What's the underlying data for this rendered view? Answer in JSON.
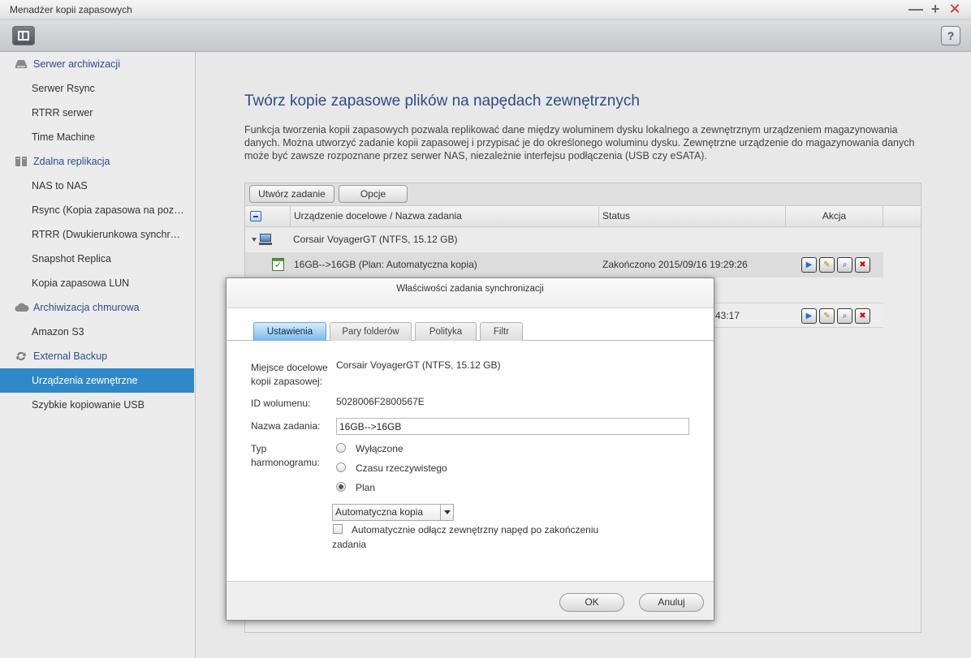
{
  "window": {
    "title": "Menadżer kopii zapasowych",
    "minimize": "—",
    "maximize": "+",
    "close": "✕"
  },
  "toolbar": {
    "help": "?"
  },
  "sidebar": {
    "groups": [
      {
        "label": "Serwer archiwizacji",
        "icon": "server-icon"
      },
      {
        "label": "Zdalna replikacja",
        "icon": "replication-icon"
      },
      {
        "label": "Archiwizacja chmurowa",
        "icon": "cloud-icon"
      },
      {
        "label": "External Backup",
        "icon": "sync-icon"
      }
    ],
    "items": [
      {
        "label": "Serwer Rsync"
      },
      {
        "label": "RTRR serwer"
      },
      {
        "label": "Time Machine"
      },
      {
        "label": "NAS to NAS"
      },
      {
        "label": "Rsync (Kopia zapasowa na poziomie plików)"
      },
      {
        "label": "RTRR (Dwukierunkowa synchronizacja)"
      },
      {
        "label": "Snapshot Replica"
      },
      {
        "label": "Kopia zapasowa LUN"
      },
      {
        "label": "Amazon S3"
      },
      {
        "label": "Urządzenia zewnętrzne"
      },
      {
        "label": "Szybkie kopiowanie USB"
      }
    ]
  },
  "main": {
    "title": "Twórz kopie zapasowe plików na napędach zewnętrznych",
    "description": "Funkcja tworzenia kopii zapasowych pozwala replikować dane między woluminem dysku lokalnego a zewnętrznym urządzeniem magazynowania danych. Można utworzyć zadanie kopii zapasowej i przypisać je do określonego woluminu dysku. Zewnętrzne urządzenie do magazynowania danych może być zawsze rozpoznane przez serwer NAS, niezależnie interfejsu podłączenia (USB czy eSATA).",
    "buttons": {
      "create": "Utwórz zadanie",
      "options": "Opcje"
    },
    "columns": {
      "target": "Urządzenie docelowe / Nazwa zadania",
      "status": "Status",
      "action": "Akcja"
    },
    "device": {
      "name": "Corsair VoyagerGT (NTFS, 15.12 GB)"
    },
    "task1": {
      "name": "16GB-->16GB (Plan: Automatyczna kopia)",
      "status": "Zakończono 2015/09/16 19:29:26"
    },
    "task2": {
      "status_tail": "43:17"
    },
    "actions": {
      "play": "▶",
      "edit": "✎",
      "view": "⌕",
      "delete": "✖"
    }
  },
  "dialog": {
    "title": "Właściwości zadania synchronizacji",
    "tabs": [
      "Ustawienia",
      "Pary folderów",
      "Polityka",
      "Filtr"
    ],
    "fields": {
      "dest_label_1": "Miejsce docelowe",
      "dest_label_2": "kopii zapasowej:",
      "dest_value": "Corsair VoyagerGT (NTFS, 15.12 GB)",
      "volume_label": "ID wolumenu:",
      "volume_value": "5028006F2800567E",
      "name_label": "Nazwa zadania:",
      "name_value": "16GB-->16GB",
      "schedule_label_1": "Typ",
      "schedule_label_2": "harmonogramu:"
    },
    "schedule": {
      "options": [
        "Wyłączone",
        "Czasu rzeczywistego",
        "Plan"
      ],
      "selected": "Plan",
      "plan_value": "Automatyczna kopia"
    },
    "detach_label": "Automatycznie odłącz zewnętrzny napęd po zakończeniu zadania",
    "ok": "OK",
    "cancel": "Anuluj"
  }
}
